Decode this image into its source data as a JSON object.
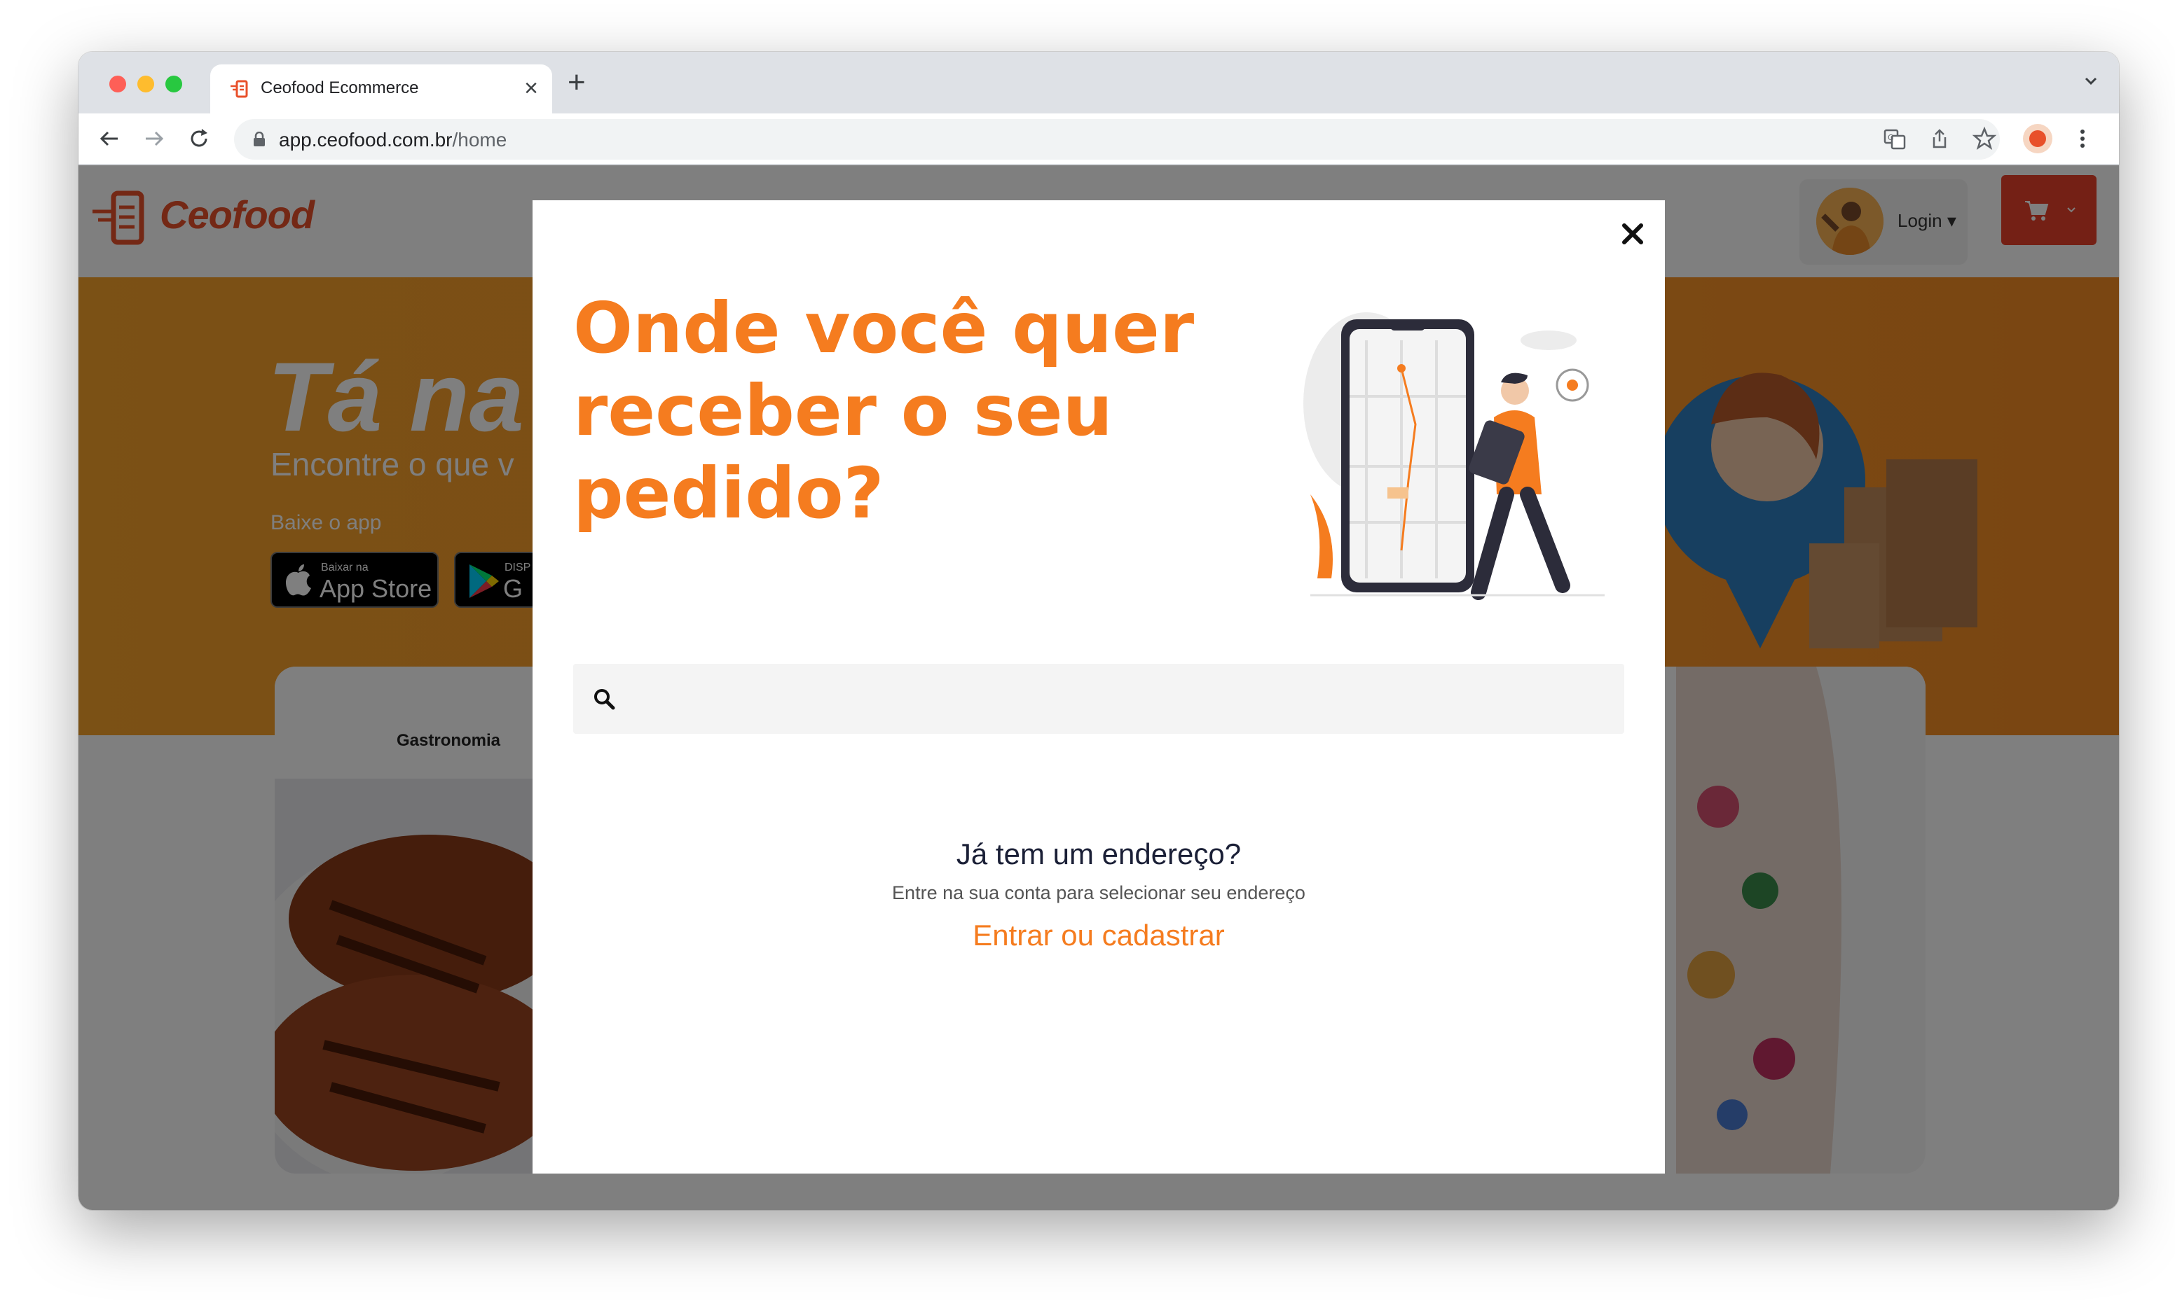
{
  "browser": {
    "tab_title": "Ceofood Ecommerce",
    "tab_close": "×",
    "new_tab": "+",
    "url_host": "app.ceofood.com.br",
    "url_path": "/home"
  },
  "site": {
    "logo_text": "Ceofood",
    "login_label": "Login ▾",
    "hero_title": "Tá na",
    "hero_subtitle": "Encontre o que v",
    "app_label": "Baixe o app",
    "appstore_small": "Baixar na",
    "appstore_big": "App Store",
    "googleplay_small": "DISP",
    "googleplay_big": "G",
    "category_label": "Gastronomia"
  },
  "modal": {
    "title": "Onde você quer receber o seu pedido?",
    "search_placeholder": "",
    "address_question": "Já tem um endereço?",
    "address_hint": "Entre na sua conta para selecionar seu endereço",
    "login_link": "Entrar ou cadastrar"
  },
  "colors": {
    "brand_orange": "#f57c1f",
    "brand_red": "#e8402a",
    "hero_orange": "#f89a2a"
  }
}
